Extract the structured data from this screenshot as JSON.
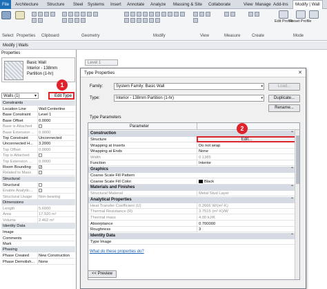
{
  "tabbar": {
    "file": "File",
    "tabs": [
      "Architecture",
      "Structure",
      "Steel",
      "Systems",
      "Insert",
      "Annotate",
      "Analyze",
      "Massing & Site",
      "Collaborate",
      "View",
      "Manage",
      "Add-Ins",
      "Modify | Wall"
    ]
  },
  "ribbon": {
    "select_label": "Select",
    "properties_label": "Properties",
    "clipboard_label": "Clipboard",
    "geometry_label": "Geometry",
    "modify_label": "Modify",
    "view_label": "View",
    "measure_label": "Measure",
    "create_label": "Create",
    "edit_profile": "Edit Profile",
    "reset_profile": "Reset Profile",
    "modifyw_label": "Mode"
  },
  "modbar": {
    "text": "Modify | Walls"
  },
  "properties": {
    "title": "Properties",
    "wall_name": [
      "Basic Wall",
      "Interior - 138mm",
      "Partition (1-hr)"
    ],
    "type_selector": "Walls (1)",
    "edit_type": "Edit Type",
    "sections": {
      "constraints": "Constraints",
      "structural": "Structural",
      "dimensions": "Dimensions",
      "identity": "Identity Data",
      "phasing": "Phasing"
    },
    "constraints_rows": [
      {
        "k": "Location Line",
        "v": "Wall Centerline",
        "grey": false
      },
      {
        "k": "Base Constraint",
        "v": "Level 1",
        "grey": false
      },
      {
        "k": "Base Offset",
        "v": "0.0000",
        "grey": false
      },
      {
        "k": "Base is Attached",
        "v": "",
        "grey": true
      },
      {
        "k": "Base Extension ...",
        "v": "0.0000",
        "grey": true
      },
      {
        "k": "Top Constraint",
        "v": "Unconnected",
        "grey": false
      },
      {
        "k": "Unconnected H...",
        "v": "3.2000",
        "grey": false
      },
      {
        "k": "Top Offset",
        "v": "0.0000",
        "grey": true
      },
      {
        "k": "Top is Attached",
        "v": "",
        "grey": true
      },
      {
        "k": "Top Extension ...",
        "v": "0.0000",
        "grey": true
      },
      {
        "k": "Room Bounding",
        "v": "",
        "grey": false
      },
      {
        "k": "Related to Mass",
        "v": "",
        "grey": true
      }
    ],
    "structural_rows": [
      {
        "k": "Structural",
        "v": "",
        "grey": false
      },
      {
        "k": "Enable Analytic...",
        "v": "",
        "grey": true
      },
      {
        "k": "Structural Usage",
        "v": "Non-bearing",
        "grey": true
      }
    ],
    "dimension_rows": [
      {
        "k": "Length",
        "v": "5.6000",
        "grey": true
      },
      {
        "k": "Area",
        "v": "17.920 m²",
        "grey": true
      },
      {
        "k": "Volume",
        "v": "2.462 m³",
        "grey": true
      }
    ],
    "identity_rows": [
      {
        "k": "Image",
        "v": "",
        "grey": false
      },
      {
        "k": "Comments",
        "v": "",
        "grey": false
      },
      {
        "k": "Mark",
        "v": "",
        "grey": false
      }
    ],
    "phasing_rows": [
      {
        "k": "Phase Created",
        "v": "New Construction",
        "grey": false
      },
      {
        "k": "Phase Demolish...",
        "v": "None",
        "grey": false
      }
    ]
  },
  "view": {
    "tab": "Level 1"
  },
  "dialog": {
    "title": "Type Properties",
    "family_label": "Family:",
    "family_value": "System Family: Basic Wall",
    "type_label": "Type:",
    "type_value": "Interior - 138mm Partition (1-hr)",
    "load": "Load...",
    "duplicate": "Duplicate...",
    "rename": "Rename...",
    "type_parameters": "Type Parameters",
    "col_parameter": "Parameter",
    "sections": {
      "construction": "Construction",
      "graphics": "Graphics",
      "materials": "Materials and Finishes",
      "analytical": "Analytical Properties",
      "identity": "Identity Data"
    },
    "construction_rows": [
      {
        "k": "Structure",
        "v": "",
        "grey": false
      },
      {
        "k": "Wrapping at Inserts",
        "v": "Do not wrap",
        "grey": false
      },
      {
        "k": "Wrapping at Ends",
        "v": "None",
        "grey": false
      },
      {
        "k": "Width",
        "v": "0.1385",
        "grey": true
      },
      {
        "k": "Function",
        "v": "Interior",
        "grey": false
      }
    ],
    "edit_button": "Edit...",
    "graphics_rows": [
      {
        "k": "Coarse Scale Fill Pattern",
        "v": "",
        "grey": false
      },
      {
        "k": "Coarse Scale Fill Color",
        "v": "Black",
        "grey": false
      }
    ],
    "materials_rows": [
      {
        "k": "Structural Material",
        "v": "Metal Stud Layer",
        "grey": true
      }
    ],
    "analytical_rows": [
      {
        "k": "Heat Transfer Coefficient (U)",
        "v": "0.2666 W/(m²·K)",
        "grey": true
      },
      {
        "k": "Thermal Resistance (R)",
        "v": "3.7515 (m²·K)/W",
        "grey": true
      },
      {
        "k": "Thermal mass",
        "v": "4.00 kJ/K",
        "grey": true
      },
      {
        "k": "Absorptance",
        "v": "0.700000",
        "grey": false
      },
      {
        "k": "Roughness",
        "v": "3",
        "grey": false
      }
    ],
    "identity_rows": [
      {
        "k": "Type Image",
        "v": "",
        "grey": false
      }
    ],
    "help_link": "What do these properties do?",
    "preview": "<< Preview"
  },
  "badges": {
    "one": "1",
    "two": "2"
  },
  "colors": {
    "accent": "#1d6fb8",
    "highlight": "#e0222a"
  }
}
